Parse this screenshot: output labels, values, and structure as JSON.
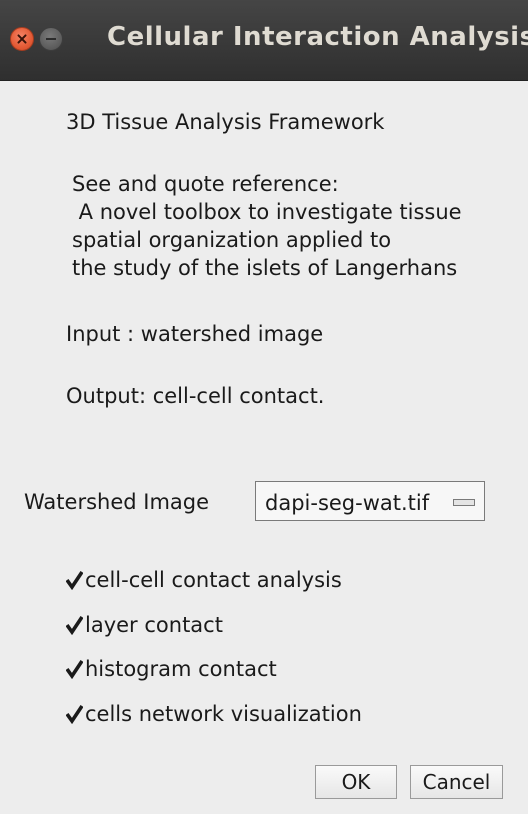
{
  "window": {
    "title": "Cellular Interaction Analysis"
  },
  "info": {
    "heading": "3D Tissue Analysis Framework",
    "reference_lines": [
      "See and quote reference:",
      " A novel toolbox to investigate tissue",
      "spatial organization applied to",
      "the study of the islets of Langerhans"
    ],
    "input": "Input : watershed image",
    "output": "Output: cell-cell contact."
  },
  "watershed": {
    "label": "Watershed Image",
    "selected": "dapi-seg-wat.tif"
  },
  "options": [
    {
      "label": "cell-cell contact analysis",
      "checked": true
    },
    {
      "label": "layer contact",
      "checked": true
    },
    {
      "label": "histogram contact",
      "checked": true
    },
    {
      "label": "cells network visualization",
      "checked": true
    }
  ],
  "buttons": {
    "ok": "OK",
    "cancel": "Cancel"
  }
}
